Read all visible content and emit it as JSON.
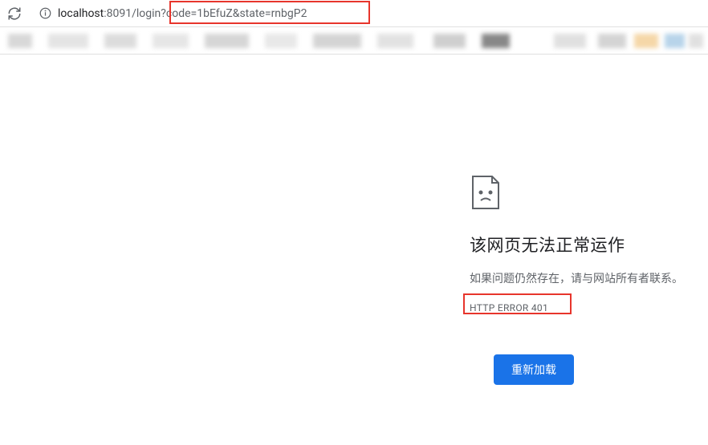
{
  "address": {
    "host": "localhost",
    "port_path": ":8091/login",
    "query": "?code=1bEfuZ&state=rnbgP2"
  },
  "error": {
    "title": "该网页无法正常运作",
    "message": "如果问题仍然存在，请与网站所有者联系。",
    "code": "HTTP ERROR 401",
    "reload_label": "重新加载"
  }
}
